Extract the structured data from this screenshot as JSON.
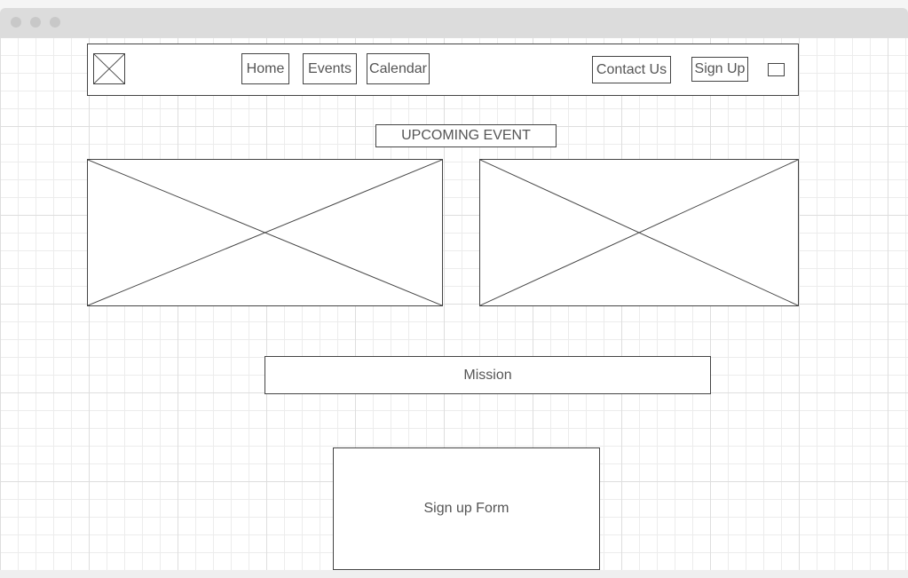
{
  "window": {
    "controls": [
      "close-dot",
      "minimize-dot",
      "maximize-dot"
    ]
  },
  "header": {
    "logo_icon": "image-placeholder-icon",
    "nav": [
      {
        "label": "Home"
      },
      {
        "label": "Events"
      },
      {
        "label": "Calendar"
      }
    ],
    "contact_label": "Contact Us",
    "signup_label": "Sign Up",
    "menu_icon": "menu-placeholder-icon"
  },
  "events": {
    "heading": "UPCOMING EVENT",
    "images": [
      "event-image-placeholder",
      "event-image-placeholder"
    ]
  },
  "mission": {
    "label": "Mission"
  },
  "signup_form": {
    "label": "Sign up Form"
  },
  "colors": {
    "stroke": "#444444",
    "text": "#555555",
    "grid": "#ececec",
    "titlebar": "#dcdcdc"
  }
}
